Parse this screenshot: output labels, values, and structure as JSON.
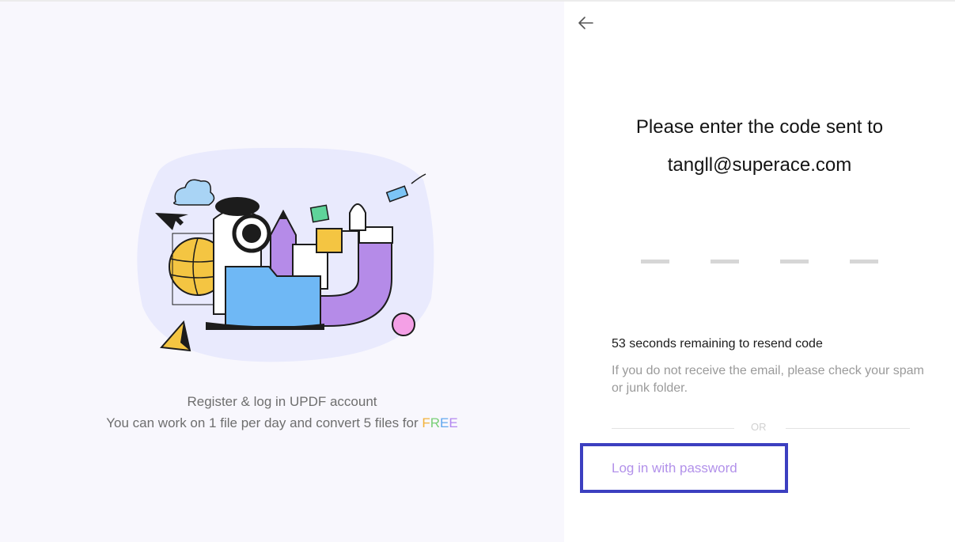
{
  "left": {
    "promo_line_1": "Register & log in UPDF account",
    "promo_line_2": "You can work on 1 file per day and convert 5 files for ",
    "free_letters": [
      "F",
      "R",
      "E",
      "E"
    ]
  },
  "right": {
    "back_icon": "arrow-left-icon",
    "title_line_1": "Please enter the code sent to",
    "title_line_2": "tangll@superace.com",
    "code_slot_count": 4,
    "countdown": "53 seconds remaining to resend code",
    "hint": "If you do not receive the email, please check your spam or junk folder.",
    "or_label": "OR",
    "login_with_password": "Log in with password"
  },
  "colors": {
    "left_bg": "#f8f7fd",
    "link": "#b291ea",
    "highlight_border": "#3c3fc0",
    "free_F": "#f2b23a",
    "free_R": "#79cf77",
    "free_E1": "#62a8ef",
    "free_E2": "#b388f0"
  }
}
